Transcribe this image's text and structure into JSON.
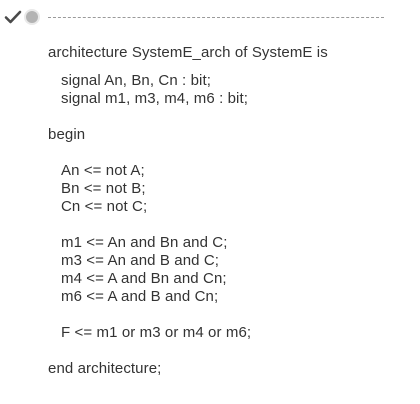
{
  "header": {
    "status_icon": "check-icon",
    "marker_icon": "dot-icon"
  },
  "code": {
    "line_architecture": "architecture SystemE_arch of SystemE is",
    "line_signal_1": "signal An, Bn, Cn : bit;",
    "line_signal_2": "signal m1, m3, m4, m6 : bit;",
    "line_begin": "begin",
    "line_an": "An <= not A;",
    "line_bn": "Bn <= not B;",
    "line_cn": "Cn <= not C;",
    "line_m1": "m1 <= An and Bn and C;",
    "line_m3": "m3 <= An and B and C;",
    "line_m4": "m4 <= A and Bn and Cn;",
    "line_m6": "m6 <= A and B and Cn;",
    "line_f": "F <= m1 or m3 or m4 or m6;",
    "line_end": "end architecture;"
  },
  "colors": {
    "text": "#333333",
    "check": "#4a4a4a",
    "dot": "#b3b3b3",
    "divider": "#9a9a9a"
  }
}
